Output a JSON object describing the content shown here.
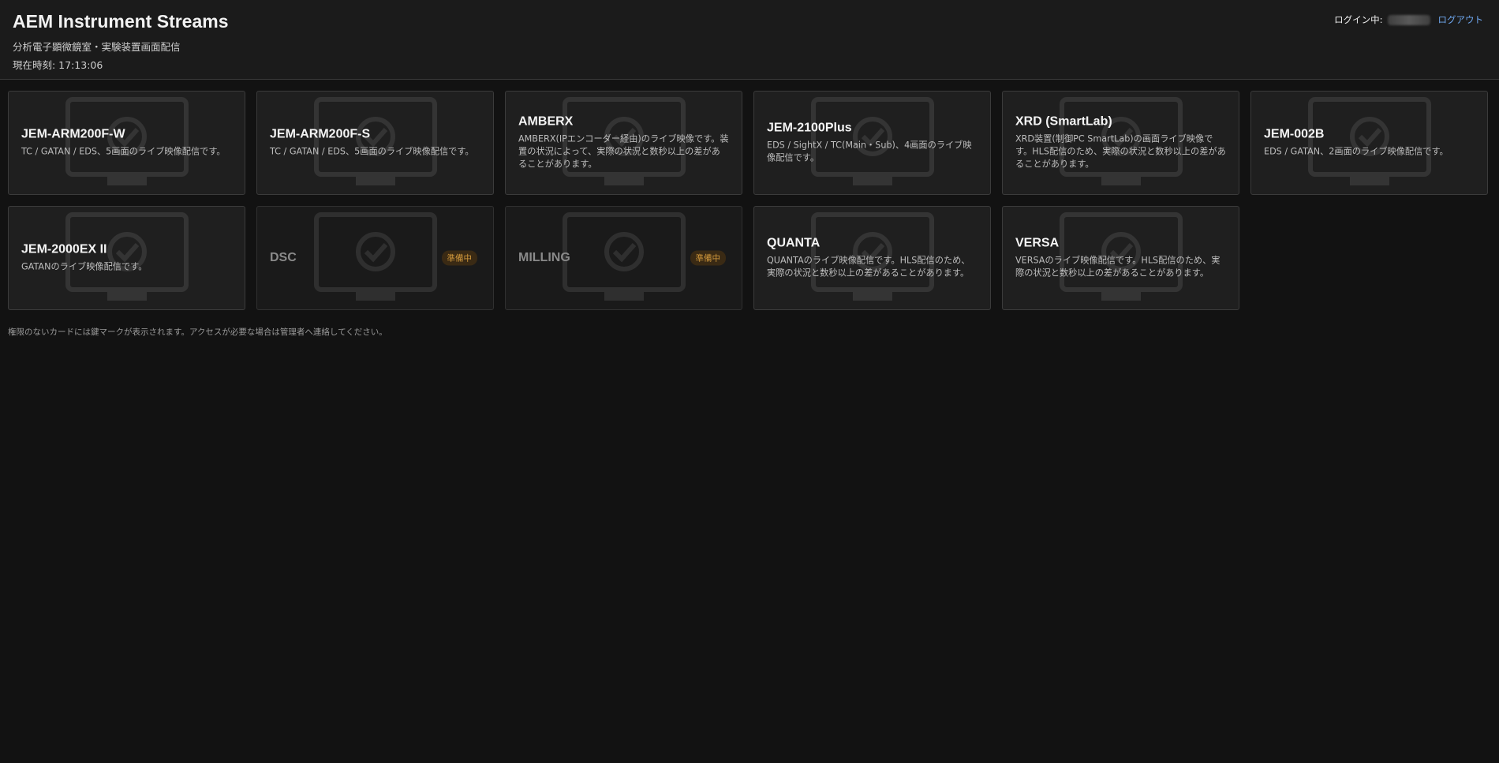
{
  "header": {
    "title": "AEM Instrument Streams",
    "subtitle": "分析電子顕微鏡室・実験装置画面配信",
    "clock": "現在時刻: 17:13:06",
    "login_label": "ログイン中:",
    "logout_label": "ログアウト",
    "logout_color": "#6fa8f0"
  },
  "cards": [
    {
      "title": "JEM-ARM200F-W",
      "description": "TC / GATAN / EDS、5画面のライブ映像配信です。",
      "status": ""
    },
    {
      "title": "JEM-ARM200F-S",
      "description": "TC / GATAN / EDS、5画面のライブ映像配信です。",
      "status": ""
    },
    {
      "title": "AMBERX",
      "description": "AMBERX(IPエンコーダー経由)のライブ映像です。装置の状況によって、実際の状況と数秒以上の差があることがあります。",
      "status": ""
    },
    {
      "title": "JEM-2100Plus",
      "description": "EDS / SightX / TC(Main・Sub)、4画面のライブ映像配信です。",
      "status": ""
    },
    {
      "title": "XRD (SmartLab)",
      "description": "XRD装置(制御PC SmartLab)の画面ライブ映像です。HLS配信のため、実際の状況と数秒以上の差があることがあります。",
      "status": ""
    },
    {
      "title": "JEM-002B",
      "description": "EDS / GATAN、2画面のライブ映像配信です。",
      "status": ""
    },
    {
      "title": "JEM-2000EX II",
      "description": "GATANのライブ映像配信です。",
      "status": ""
    },
    {
      "title": "DSC",
      "description": "",
      "status": "準備中"
    },
    {
      "title": "MILLING",
      "description": "",
      "status": "準備中"
    },
    {
      "title": "QUANTA",
      "description": "QUANTAのライブ映像配信です。HLS配信のため、実際の状況と数秒以上の差があることがあります。",
      "status": ""
    },
    {
      "title": "VERSA",
      "description": "VERSAのライブ映像配信です。HLS配信のため、実際の状況と数秒以上の差があることがあります。",
      "status": ""
    }
  ],
  "card_icon": "monitor-check-icon",
  "badge_color": "#d49a3c",
  "footnote": "権限のないカードには鍵マークが表示されます。アクセスが必要な場合は管理者へ連絡してください。"
}
